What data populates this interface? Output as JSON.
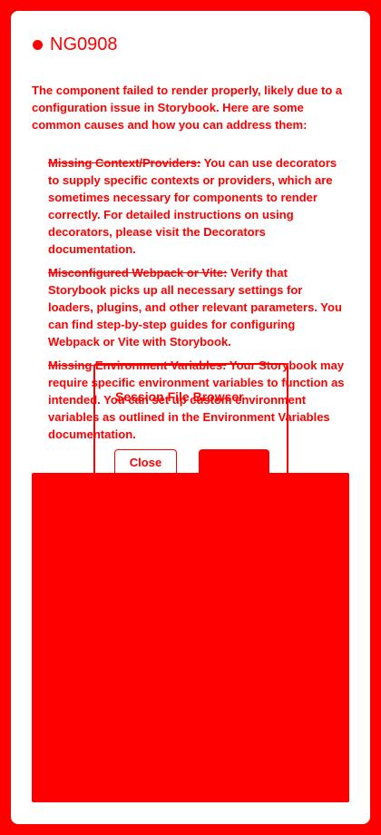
{
  "error": {
    "code": "NG0908",
    "intro": "The component failed to render properly, likely due to a configuration issue in Storybook. Here are some common causes and how you can address them:",
    "causes": [
      {
        "title": "Missing Context/Providers:",
        "text": " You can use decorators to supply specific contexts or providers, which are sometimes necessary for components to render correctly. For detailed instructions on using decorators, please visit the Decorators documentation."
      },
      {
        "title": "Misconfigured Webpack or Vite:",
        "text": " Verify that Storybook picks up all necessary settings for loaders, plugins, and other relevant parameters. You can find step-by-step guides for configuring Webpack or Vite with Storybook."
      },
      {
        "title": "Missing Environment Variables:",
        "text": " Your Storybook may require specific environment variables to function as intended. You can set up custom environment variables as outlined in the Environment Variables documentation."
      }
    ]
  },
  "dialog": {
    "title": "Session File Browser",
    "close_label": "Close"
  },
  "colors": {
    "accent": "#ff0000",
    "background": "#ffffff"
  }
}
